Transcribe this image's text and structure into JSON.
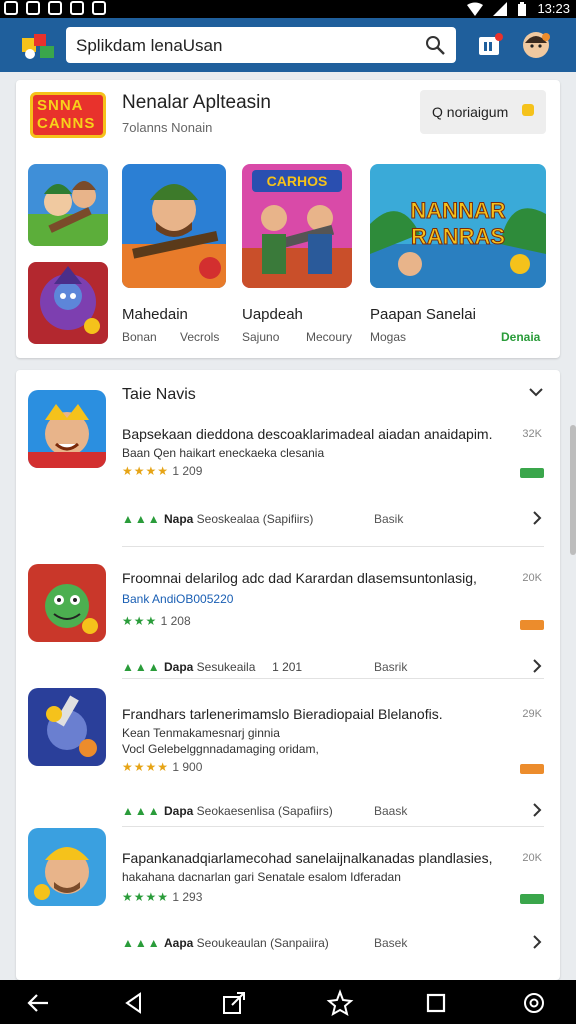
{
  "status_bar": {
    "time": "13:23"
  },
  "app_bar": {
    "search_value": "Splikdam lenaUsan",
    "search_icon": "search-icon"
  },
  "featured": {
    "logo_line1": "SNNA",
    "logo_line2": "CANNS",
    "title": "Nenalar Aplteasin",
    "subtitle": "7olanns Nonain",
    "button_label": "Q noriaigum",
    "games": [
      {
        "name": "Mahedain",
        "meta_left": "Bonan",
        "meta_right": "Vecrols"
      },
      {
        "name": "Uapdeah",
        "meta_left": "Sajuno",
        "meta_right": "Mecoury"
      },
      {
        "name": "Paapan Sanelai",
        "meta_left": "Mogas",
        "meta_right": "Denaia"
      }
    ],
    "banner_text_1": "NANNAR",
    "banner_text_2": "RANRAS",
    "poster_text": "CARHOS"
  },
  "news": {
    "title": "Taie Navis",
    "items": [
      {
        "title": "Bapsekaan dieddona descoaklarimadeal aiadan anaidapim.",
        "subtitle": "Baan  Qen haikart eneckaeka clesania",
        "rating": "1 209",
        "size": "32K",
        "foot_label": "Napa",
        "foot_text": "Seoskealaa (Sapifiirs)",
        "foot_extra": "",
        "basic": "Basik",
        "tag_color": "#3aa64b"
      },
      {
        "title": "Froomnai delarilog adc dad Karardan dlasemsuntonlasig,",
        "subtitle": "Bank  AndiOB005220",
        "rating": "1 208",
        "size": "20K",
        "foot_label": "Dapa",
        "foot_text": "Sesukeaila",
        "foot_extra": "1 201",
        "basic": "Basrik",
        "tag_color": "#ec8c2c"
      },
      {
        "title": "Frandhars tarlenerimamslo Bieradiopaial Blelanofis.",
        "subtitle": "Kean  Tenmakamesnarj ginnia",
        "subtitle2": "Vocl  Gelebelggnnadamaging oridam,",
        "rating": "1 900",
        "size": "29K",
        "foot_label": "Dapa",
        "foot_text": "Seokaesenlisa (Sapafiirs)",
        "foot_extra": "",
        "basic": "Baask",
        "tag_color": "#ec8c2c"
      },
      {
        "title": "Fapankanadqiarlamecohad sanelaijnalkanadas plandlasies,",
        "subtitle": "hakahana dacnarlan gari Senatale esalom Idferadan",
        "rating": "1 293",
        "size": "20K",
        "foot_label": "Aapa",
        "foot_text": "Seoukeaulan (Sanpaiira)",
        "foot_extra": "",
        "basic": "Basek",
        "tag_color": "#3aa64b"
      }
    ]
  },
  "colors": {
    "app_bar": "#1f5f9c",
    "accent_green": "#2a9c3a",
    "star_gold": "#e6a416"
  }
}
